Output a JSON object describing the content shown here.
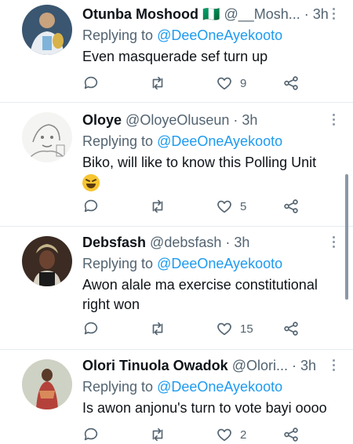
{
  "tweets": [
    {
      "name": "Otunba Moshood",
      "flag": "🇳🇬",
      "handle": "@__Mosh...",
      "time": "· 3h",
      "replying_prefix": "Replying to ",
      "replying_to": "@DeeOneAyekooto",
      "text": "Even masquerade sef turn up",
      "like_count": "9",
      "retweet_count": "",
      "reply_count": ""
    },
    {
      "name": "Oloye",
      "handle": "@OloyeOluseun",
      "time": "· 3h",
      "replying_prefix": "Replying to ",
      "replying_to": "@DeeOneAyekooto",
      "text": "Biko, will like to know this Polling Unit",
      "emoji": "grinning-squinting-face",
      "like_count": "5",
      "retweet_count": "",
      "reply_count": ""
    },
    {
      "name": "Debsfash",
      "handle": "@debsfash",
      "time": "· 3h",
      "replying_prefix": "Replying to ",
      "replying_to": "@DeeOneAyekooto",
      "text": "Awon alale ma exercise constitutional right won",
      "like_count": "15",
      "retweet_count": "",
      "reply_count": ""
    },
    {
      "name": "Olori Tinuola Owadok",
      "handle": "@Olori...",
      "time": "· 3h",
      "replying_prefix": "Replying to ",
      "replying_to": "@DeeOneAyekooto",
      "text": "Is awon anjonu's turn to vote bayi oooo",
      "like_count": "2",
      "retweet_count": "",
      "reply_count": ""
    }
  ],
  "colors": {
    "accent": "#1d9bf0",
    "secondary_text": "#536471",
    "divider": "#e6ecf0"
  }
}
